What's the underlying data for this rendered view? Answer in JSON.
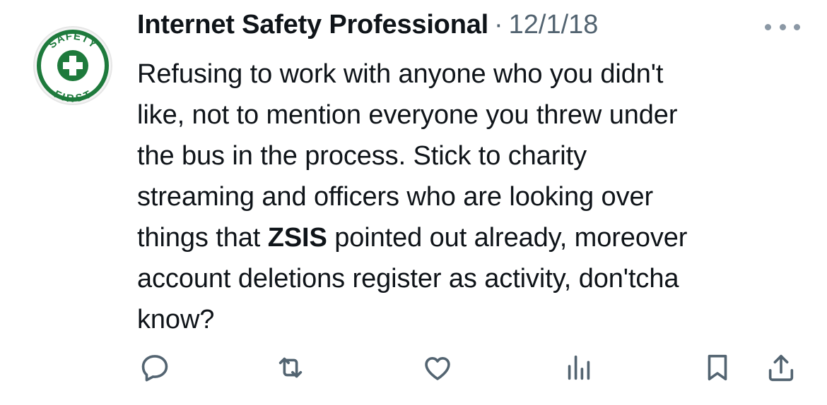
{
  "tweet": {
    "author": {
      "display_name": "Internet Safety Professional",
      "avatar_text_top": "SAFETY",
      "avatar_text_bottom": "FIRST",
      "avatar_color": "#1e7a3c"
    },
    "separator": "·",
    "timestamp": "12/1/18",
    "body": {
      "line1": "Refusing to work with anyone who you didn't",
      "line2": "like, not to mention everyone you threw under",
      "line3": "the bus in the process. Stick to charity",
      "line4": "streaming and officers who are looking over",
      "line5_pre": "things that ",
      "line5_bold": "ZSIS",
      "line5_post": " pointed out already, moreover",
      "line6": "account deletions register as activity, don'tcha",
      "line7": "know?"
    },
    "actions": [
      {
        "icon": "reply-icon"
      },
      {
        "icon": "retweet-icon"
      },
      {
        "icon": "like-icon"
      },
      {
        "icon": "views-icon"
      },
      {
        "icon": "bookmark-icon"
      },
      {
        "icon": "share-icon"
      }
    ],
    "colors": {
      "text": "#0f1419",
      "secondary": "#536471",
      "icon": "#536471"
    }
  }
}
